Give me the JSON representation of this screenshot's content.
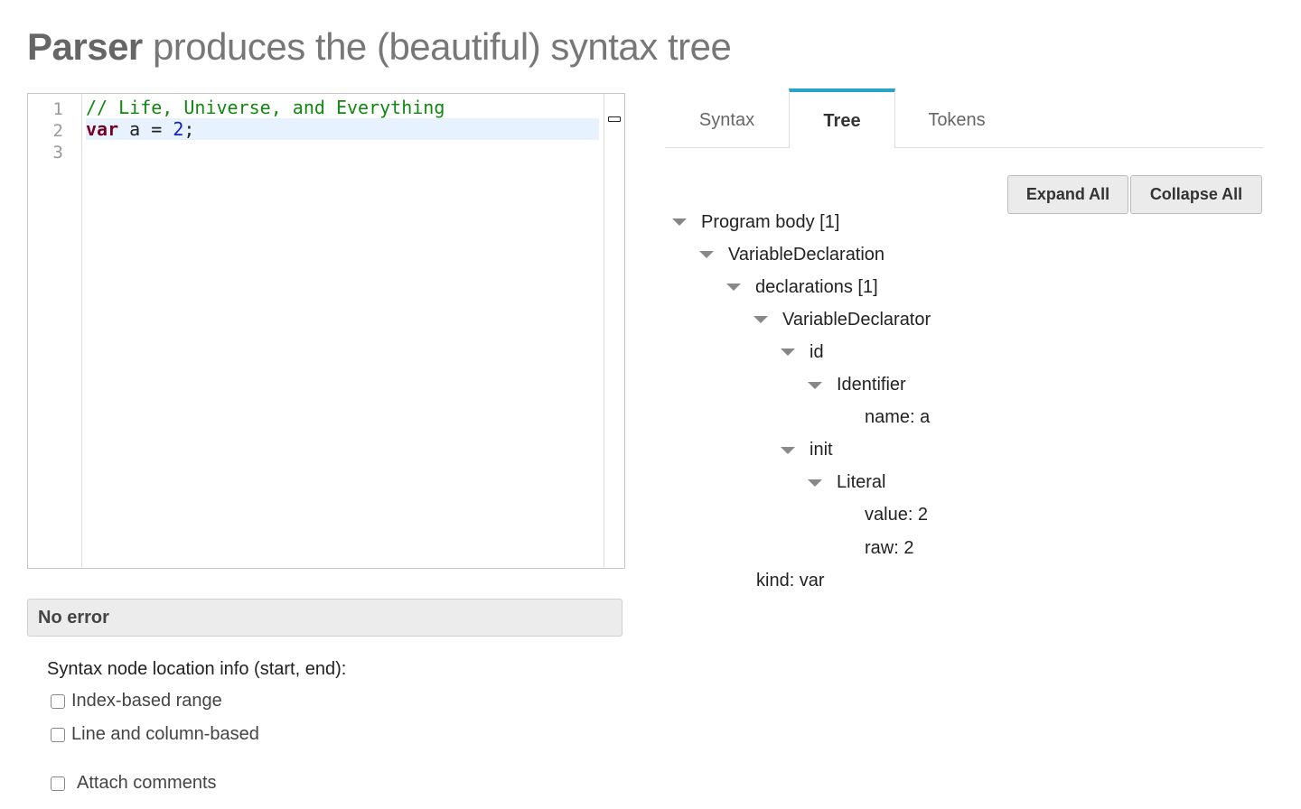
{
  "header": {
    "title_strong": "Parser",
    "title_rest": "produces the (beautiful) syntax tree"
  },
  "editor": {
    "line_numbers": [
      "1",
      "2",
      "3"
    ],
    "code": {
      "line1_comment": "// Life, Universe, and Everything",
      "line2_keyword": "var",
      "line2_mid": " a = ",
      "line2_number": "2",
      "line2_end": ";"
    }
  },
  "status": {
    "text": "No error"
  },
  "options": {
    "location_label": "Syntax node location info (start, end):",
    "index_range": "Index-based range",
    "line_column": "Line and column-based",
    "attach_comments": "Attach comments"
  },
  "tabs": [
    {
      "label": "Syntax",
      "active": false
    },
    {
      "label": "Tree",
      "active": true
    },
    {
      "label": "Tokens",
      "active": false
    }
  ],
  "buttons": {
    "expand_all": "Expand All",
    "collapse_all": "Collapse All"
  },
  "tree": [
    {
      "label": "Program body [1]",
      "depth": 0,
      "expandable": true
    },
    {
      "label": "VariableDeclaration",
      "depth": 1,
      "expandable": true
    },
    {
      "label": "declarations [1]",
      "depth": 2,
      "expandable": true
    },
    {
      "label": "VariableDeclarator",
      "depth": 3,
      "expandable": true
    },
    {
      "label": "id",
      "depth": 4,
      "expandable": true
    },
    {
      "label": "Identifier",
      "depth": 5,
      "expandable": true
    },
    {
      "label": "name: a",
      "depth": 6,
      "expandable": false
    },
    {
      "label": "init",
      "depth": 4,
      "expandable": true
    },
    {
      "label": "Literal",
      "depth": 5,
      "expandable": true
    },
    {
      "label": "value: 2",
      "depth": 6,
      "expandable": false
    },
    {
      "label": "raw: 2",
      "depth": 6,
      "expandable": false
    },
    {
      "label": "kind: var",
      "depth": 2,
      "expandable": false
    }
  ],
  "colors": {
    "tab_accent": "#2aa3c8",
    "comment": "#118811",
    "keyword": "#770022",
    "number": "#1122cc"
  }
}
